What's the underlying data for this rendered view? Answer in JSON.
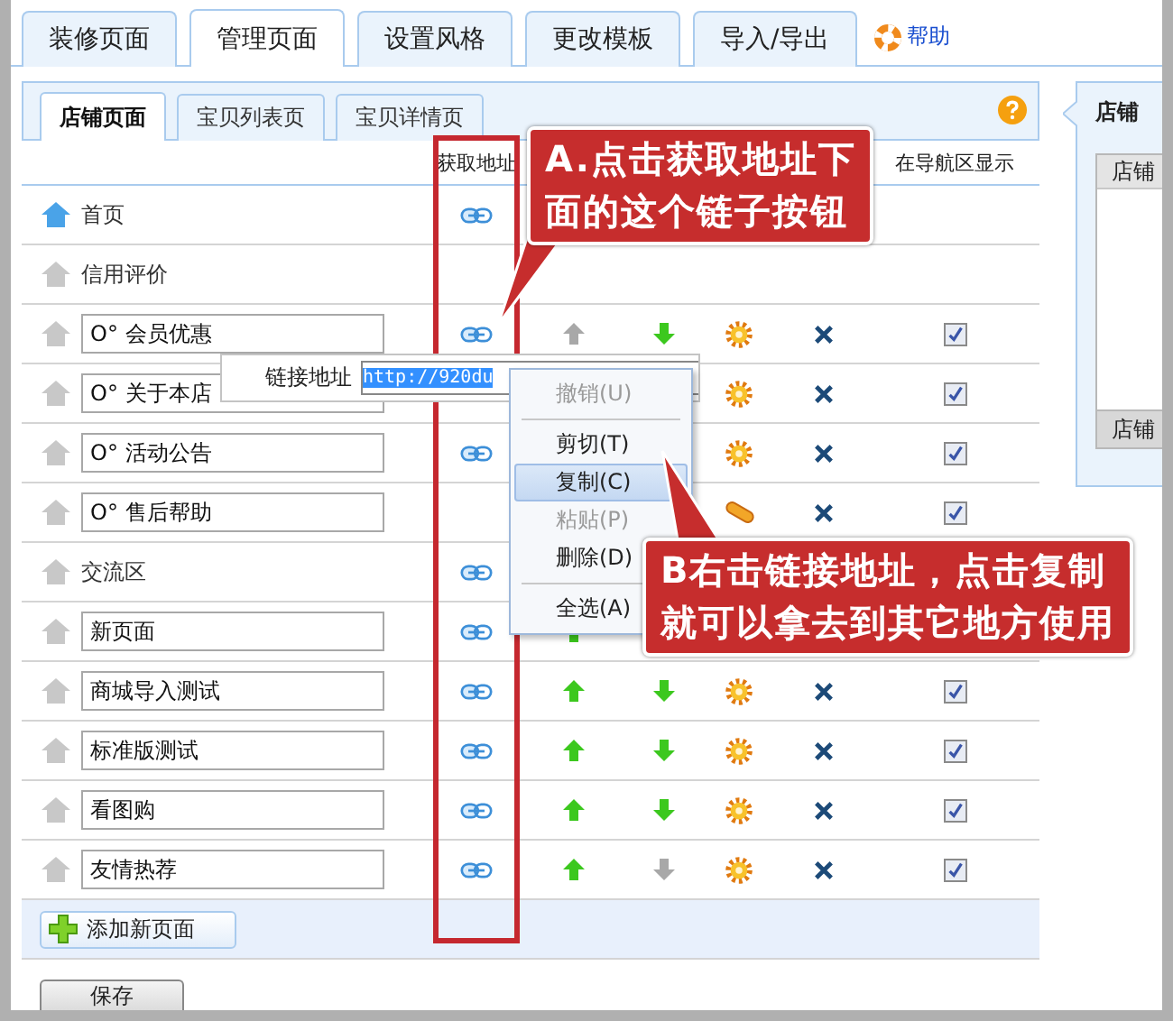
{
  "tabs": [
    {
      "label": "装修页面",
      "selected": false
    },
    {
      "label": "管理页面",
      "selected": true
    },
    {
      "label": "设置风格",
      "selected": false
    },
    {
      "label": "更改模板",
      "selected": false
    },
    {
      "label": "导入/导出",
      "selected": false
    }
  ],
  "help_link": "帮助",
  "subtabs": [
    {
      "label": "店铺页面",
      "selected": true
    },
    {
      "label": "宝贝列表页",
      "selected": false
    },
    {
      "label": "宝贝详情页",
      "selected": false
    }
  ],
  "table": {
    "columns": {
      "link": "获取地址",
      "nav": "在导航区显示"
    },
    "rows": [
      {
        "kind": "text",
        "name": "首页",
        "home_active": true,
        "link": true
      },
      {
        "kind": "text",
        "name": "信用评价",
        "home_active": false,
        "link": false
      },
      {
        "kind": "input",
        "name": "O° 会员优惠",
        "home_active": false,
        "link": true,
        "up": {
          "disabled": true
        },
        "down": {
          "disabled": false
        },
        "tool": {
          "kind": "gear"
        },
        "remove": true,
        "nav_shown": true
      },
      {
        "kind": "input",
        "name": "O° 关于本店",
        "home_active": false,
        "tool": {
          "kind": "gear"
        },
        "remove": true,
        "nav_shown": true
      },
      {
        "kind": "input",
        "name": "O° 活动公告",
        "home_active": false,
        "link": true,
        "tool": {
          "kind": "gear"
        },
        "remove": true,
        "nav_shown": true
      },
      {
        "kind": "input",
        "name": "O° 售后帮助",
        "home_active": false,
        "link": false,
        "tool": {
          "kind": "capsule"
        },
        "remove": true,
        "nav_shown": true
      },
      {
        "kind": "text",
        "name": "交流区",
        "home_active": false,
        "link": true
      },
      {
        "kind": "input",
        "name": "新页面",
        "home_active": false,
        "link": true,
        "up": {
          "disabled": false
        }
      },
      {
        "kind": "input",
        "name": "商城导入测试",
        "home_active": false,
        "link": true,
        "up": {
          "disabled": false
        },
        "down": {
          "disabled": false
        },
        "tool": {
          "kind": "gear"
        },
        "remove": true,
        "nav_shown": true
      },
      {
        "kind": "input",
        "name": "标准版测试",
        "home_active": false,
        "link": true,
        "up": {
          "disabled": false
        },
        "down": {
          "disabled": false
        },
        "tool": {
          "kind": "gear"
        },
        "remove": true,
        "nav_shown": true
      },
      {
        "kind": "input",
        "name": "看图购",
        "home_active": false,
        "link": true,
        "up": {
          "disabled": false
        },
        "down": {
          "disabled": false
        },
        "tool": {
          "kind": "gear"
        },
        "remove": true,
        "nav_shown": true
      },
      {
        "kind": "input",
        "name": "友情热荐",
        "home_active": false,
        "link": true,
        "up": {
          "disabled": false
        },
        "down": {
          "disabled": true
        },
        "tool": {
          "kind": "gear"
        },
        "remove": true,
        "nav_shown": true
      }
    ]
  },
  "add_button": "添加新页面",
  "save_button": "保存",
  "side_panel": {
    "title": "店铺",
    "table_header": "店铺",
    "footer": "店铺"
  },
  "link_popup": {
    "label": "链接地址",
    "value": "http://920du"
  },
  "context_menu": [
    {
      "label": "撤销(U)",
      "disabled": true,
      "selected": false,
      "separator_after": true
    },
    {
      "label": "剪切(T)",
      "disabled": false,
      "selected": false,
      "separator_after": false
    },
    {
      "label": "复制(C)",
      "disabled": false,
      "selected": true,
      "separator_after": false
    },
    {
      "label": "粘贴(P)",
      "disabled": true,
      "selected": false,
      "separator_after": false
    },
    {
      "label": "删除(D)",
      "disabled": false,
      "selected": false,
      "separator_after": true
    },
    {
      "label": "全选(A)",
      "disabled": false,
      "selected": false,
      "separator_after": false
    }
  ],
  "callouts": [
    {
      "kind": "a",
      "lines": [
        "A.点击获取地址下",
        "面的这个链子按钮"
      ]
    },
    {
      "kind": "b",
      "lines": [
        "B右击链接地址，点击复制",
        "就可以拿去到其它地方使用"
      ]
    }
  ]
}
